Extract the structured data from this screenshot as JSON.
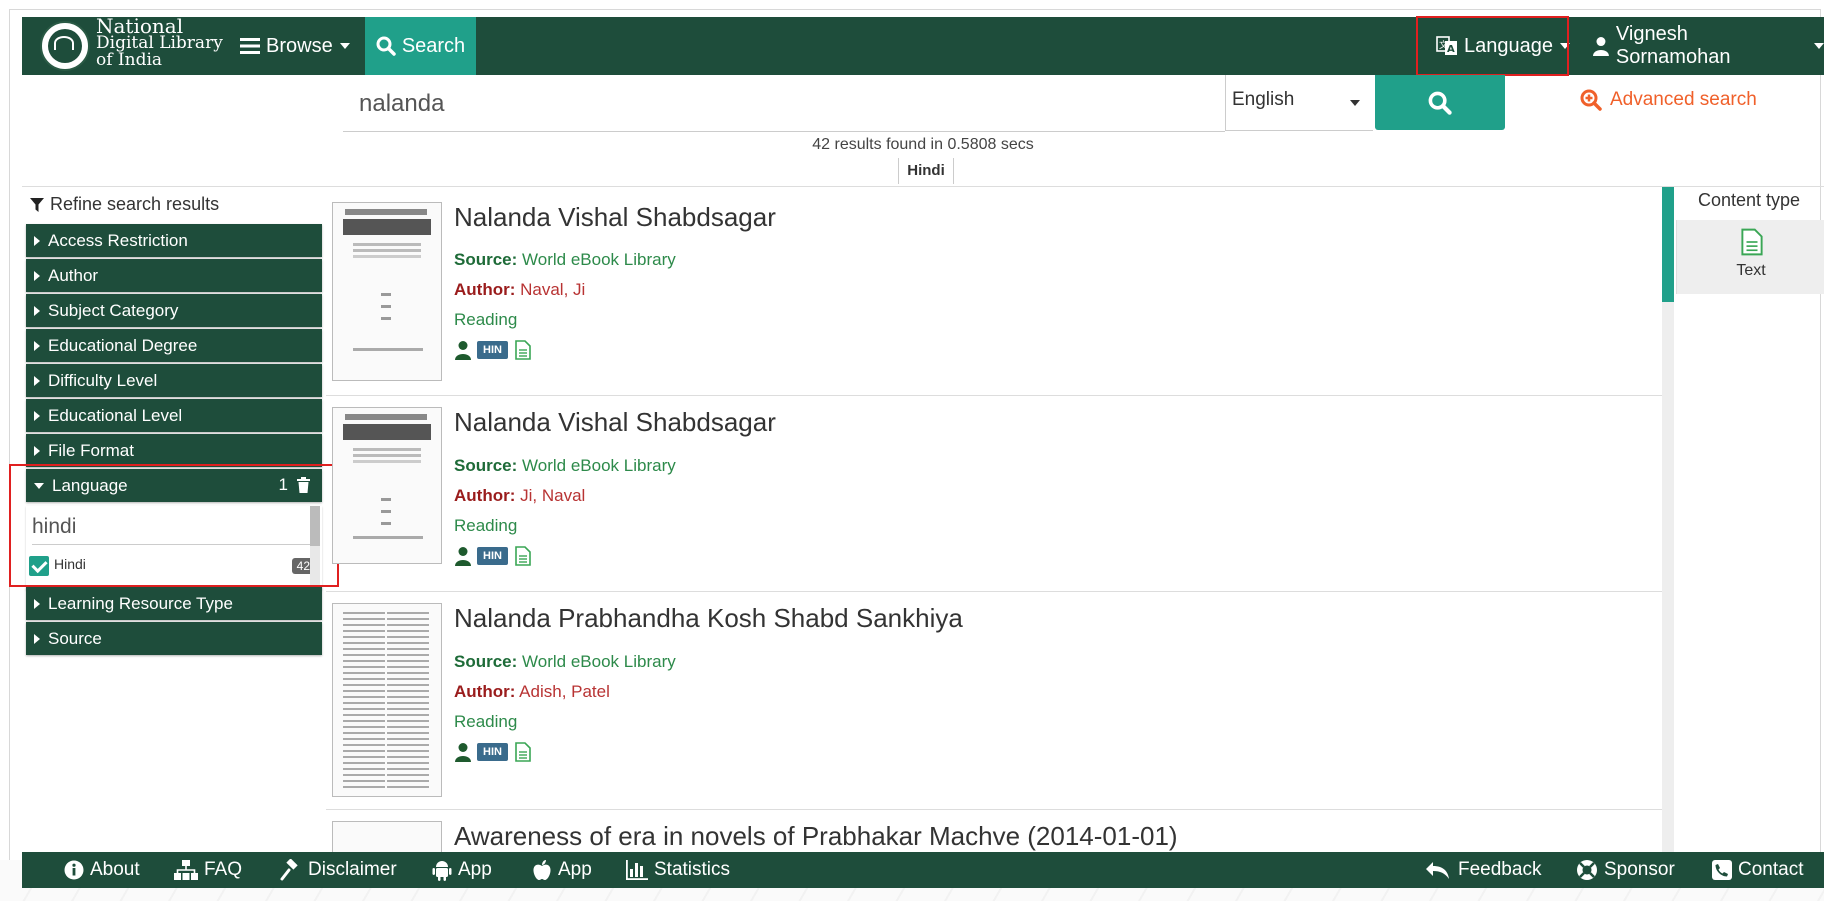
{
  "header": {
    "logo_text": [
      "National",
      "Digital Library",
      "of India"
    ],
    "browse_label": "Browse",
    "search_label": "Search",
    "language_label": "Language",
    "user_name": "Vignesh Sornamohan"
  },
  "search": {
    "query": "nalanda",
    "language_selected": "English",
    "advanced_label": "Advanced search",
    "results_info": "42 results found in 0.5808 secs",
    "active_filter": "Hindi"
  },
  "sidebar": {
    "refine_label": "Refine search results",
    "facets_top": [
      {
        "label": "Access Restriction"
      },
      {
        "label": "Author"
      },
      {
        "label": "Subject Category"
      },
      {
        "label": "Educational Degree"
      },
      {
        "label": "Difficulty Level"
      },
      {
        "label": "Educational Level"
      },
      {
        "label": "File Format"
      }
    ],
    "language_facet": {
      "label": "Language",
      "count": "1",
      "search_value": "hindi",
      "option_label": "Hindi",
      "option_count": "42"
    },
    "facets_bottom": [
      {
        "label": "Learning Resource Type"
      },
      {
        "label": "Source"
      }
    ]
  },
  "results": [
    {
      "title": "Nalanda Vishal Shabdsagar",
      "source_label": "Source:",
      "source": "World eBook Library",
      "author_label": "Author:",
      "author": "Naval, Ji",
      "status": "Reading",
      "lang_badge": "HIN"
    },
    {
      "title": "Nalanda Vishal Shabdsagar",
      "source_label": "Source:",
      "source": "World eBook Library",
      "author_label": "Author:",
      "author": "Ji, Naval",
      "status": "Reading",
      "lang_badge": "HIN"
    },
    {
      "title": "Nalanda Prabhandha Kosh Shabd Sankhiya",
      "source_label": "Source:",
      "source": "World eBook Library",
      "author_label": "Author:",
      "author": "Adish, Patel",
      "status": "Reading",
      "lang_badge": "HIN"
    },
    {
      "title": "Awareness of era in novels of Prabhakar Machve (2014-01-01)"
    }
  ],
  "content_type": {
    "heading": "Content type",
    "item": "Text"
  },
  "footer": {
    "about": "About",
    "faq": "FAQ",
    "disclaimer": "Disclaimer",
    "app_android": "App",
    "app_ios": "App",
    "statistics": "Statistics",
    "feedback": "Feedback",
    "sponsor": "Sponsor",
    "contact": "Contact"
  },
  "colors": {
    "brand_green": "#1e4d3b",
    "accent_teal": "#20a08a",
    "advanced_orange": "#f0602a",
    "highlight_red": "#e02020"
  }
}
